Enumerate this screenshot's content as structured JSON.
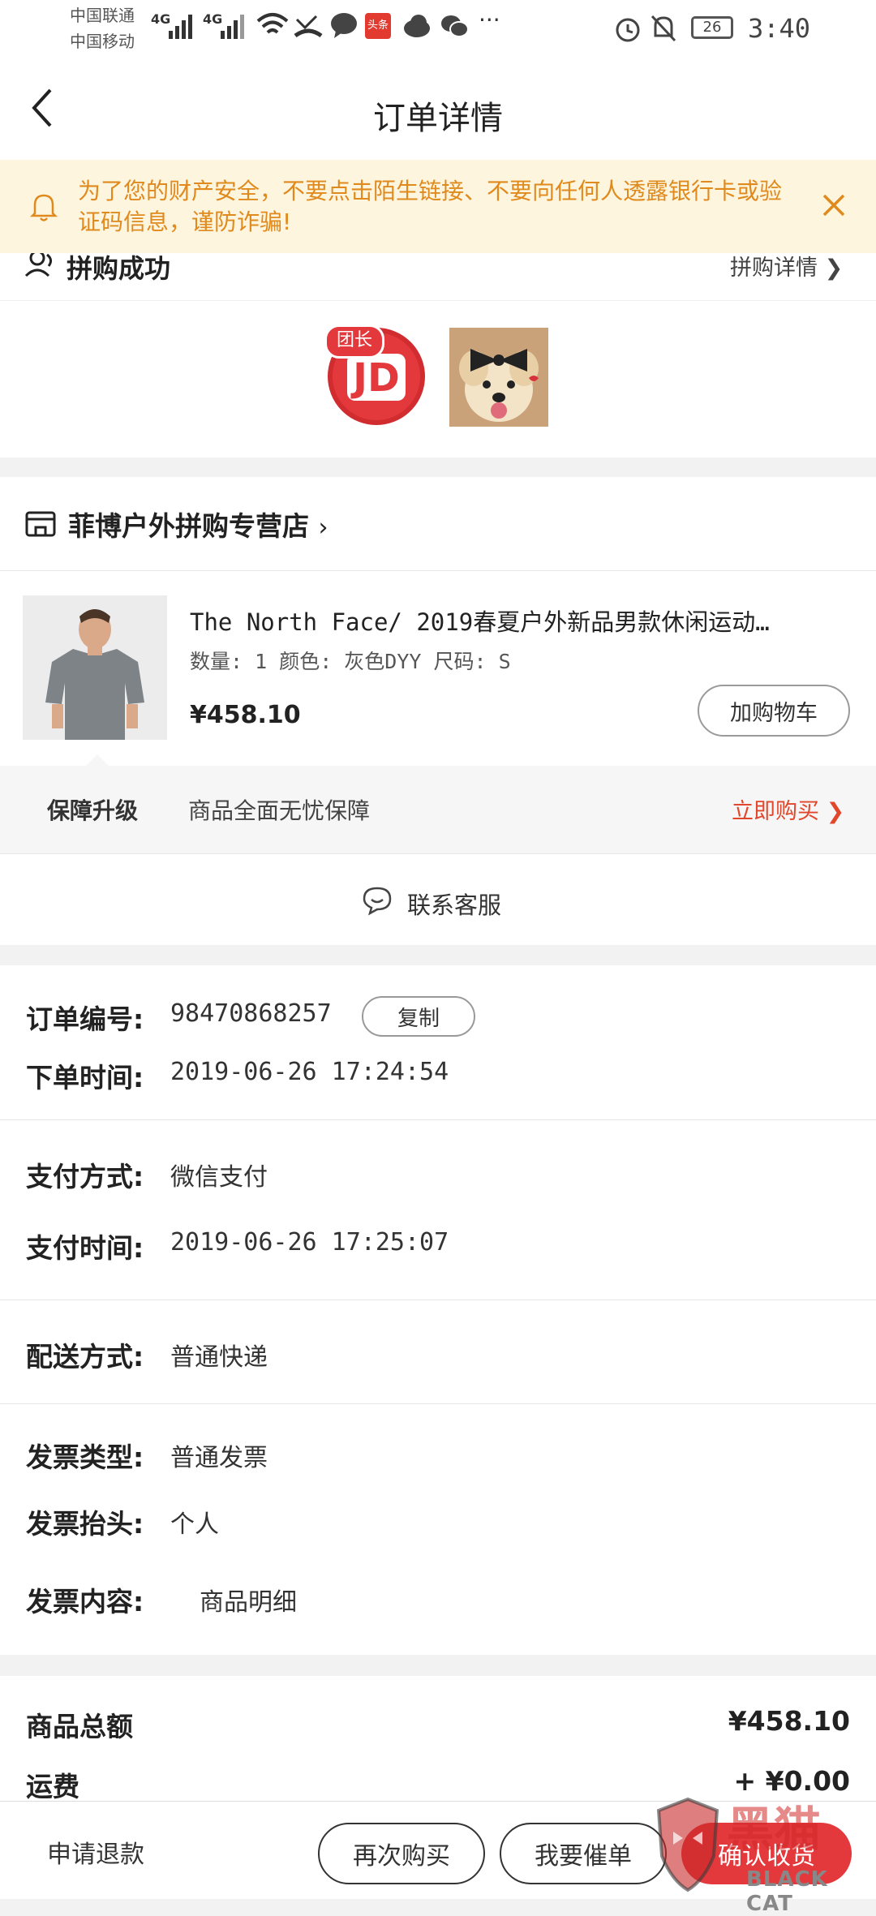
{
  "statusbar": {
    "carrier_1": "中国联通",
    "carrier_2": "中国移动",
    "net_1": "4G",
    "net_2": "4G",
    "toutiao_badge": "头条",
    "more": "···",
    "battery": "26",
    "time": "3:40"
  },
  "header": {
    "title": "订单详情"
  },
  "notice": {
    "text": "为了您的财产安全，不要点击陌生链接、不要向任何人透露银行卡或验证码信息，谨防诈骗!"
  },
  "group_buy": {
    "title": "拼购成功",
    "details_link": "拼购详情",
    "leader_badge": "团长",
    "leader_logo_text": "JD"
  },
  "store": {
    "name": "菲博户外拼购专营店"
  },
  "product": {
    "name": "The North Face/ 2019春夏户外新品男款休闲运动…",
    "meta": "数量: 1 颜色: 灰色DYY 尺码: S",
    "price": "¥458.10",
    "add_cart_label": "加购物车"
  },
  "guarantee": {
    "label": "保障升级",
    "text": "商品全面无忧保障",
    "buy_link": "立即购买"
  },
  "service": {
    "label": "联系客服"
  },
  "order_info": {
    "order_no_label": "订单编号:",
    "order_no": "98470868257",
    "copy_label": "复制",
    "order_time_label": "下单时间:",
    "order_time": "2019-06-26 17:24:54",
    "pay_method_label": "支付方式:",
    "pay_method": "微信支付",
    "pay_time_label": "支付时间:",
    "pay_time": "2019-06-26 17:25:07",
    "delivery_label": "配送方式:",
    "delivery": "普通快递",
    "invoice_type_label": "发票类型:",
    "invoice_type": "普通发票",
    "invoice_title_label": "发票抬头:",
    "invoice_title": "个人",
    "invoice_content_label": "发票内容:",
    "invoice_content": "商品明细"
  },
  "totals": {
    "goods_total_label": "商品总额",
    "goods_total": "¥458.10",
    "shipping_label": "运费",
    "shipping": "+ ¥0.00"
  },
  "bottombar": {
    "refund_label": "申请退款",
    "rebuy_label": "再次购买",
    "urge_label": "我要催单",
    "confirm_label": "确认收货"
  },
  "watermark": {
    "cn": "黑猫",
    "en": "BLACK CAT"
  },
  "colors": {
    "accent_red": "#e4393c",
    "notice_bg": "#fdf5dd",
    "notice_text": "#e08a1e"
  }
}
